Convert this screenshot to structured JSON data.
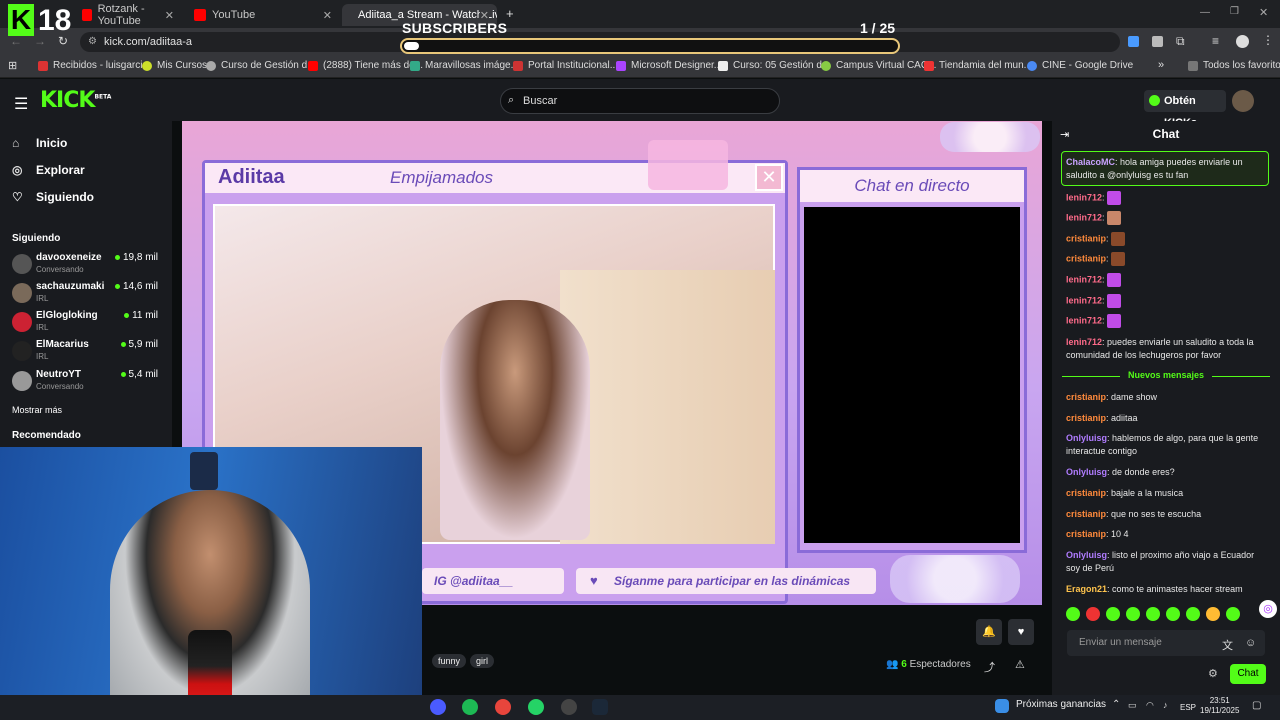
{
  "browser": {
    "tabs": [
      {
        "label": "Rotzank - YouTube"
      },
      {
        "label": "YouTube"
      },
      {
        "label": "Adiitaa_a Stream - Watch Live o"
      }
    ],
    "url": "kick.com/adiitaa-a",
    "bookmarks": [
      "Recibidos - luisgarci...",
      "Mis Cursos",
      "Curso de Gestión d...",
      "(2888) Tiene más de...",
      "Maravillosas imáge...",
      "Portal Institucional...",
      "Microsoft Designer...",
      "Curso: 05 Gestión d...",
      "Campus Virtual CAC...",
      "Tiendamia del mun...",
      "CINE - Google Drive",
      "Todos los favoritos"
    ]
  },
  "overlay_top": {
    "badge": "18",
    "sub_label": "SUBSCRIBERS",
    "sub_count": "1  / 25",
    "sub_progress": 0.04
  },
  "kick": {
    "logo": "KICK",
    "beta": "BETA",
    "search_placeholder": "Buscar",
    "get_kicks": "Obtén KICKs",
    "nav": [
      {
        "label": "Inicio",
        "icon": "home-icon"
      },
      {
        "label": "Explorar",
        "icon": "compass-icon"
      },
      {
        "label": "Siguiendo",
        "icon": "heart-icon"
      }
    ],
    "following_header": "Siguiendo",
    "following": [
      {
        "name": "davooxeneize",
        "status": "Conversando",
        "viewers": "19,8 mil"
      },
      {
        "name": "sachauzumaki",
        "status": "IRL",
        "viewers": "14,6 mil"
      },
      {
        "name": "ElGlogloking",
        "status": "IRL",
        "viewers": "11 mil"
      },
      {
        "name": "ElMacarius",
        "status": "IRL",
        "viewers": "5,9 mil"
      },
      {
        "name": "NeutroYT",
        "status": "Conversando",
        "viewers": "5,4 mil"
      }
    ],
    "show_more": "Mostrar más",
    "recommended": "Recomendado"
  },
  "stream_overlay": {
    "name": "Adiitaa",
    "title": "Empijamados",
    "live_chat": "Chat en directo",
    "ig": "IG @adiitaa__",
    "follow_msg": "Síganme para participar en las dinámicas"
  },
  "below_stream": {
    "tags": [
      "funny",
      "girl"
    ],
    "viewers_count": "6",
    "viewers_label": "Espectadores"
  },
  "chat": {
    "title": "Chat",
    "pinned": {
      "user": "ChalacoMC",
      "text": "hola amiga puedes enviarle un saludito a @onlyluisg es tu fan"
    },
    "messages": [
      {
        "user": "lenin712",
        "text": "",
        "color": "#ff6b8a"
      },
      {
        "user": "lenin712",
        "text": "",
        "color": "#ff6b8a"
      },
      {
        "user": "cristianip",
        "text": "",
        "color": "#ff8a3c"
      },
      {
        "user": "cristianip",
        "text": "",
        "color": "#ff8a3c"
      },
      {
        "user": "lenin712",
        "text": "",
        "color": "#ff6b8a"
      },
      {
        "user": "lenin712",
        "text": "",
        "color": "#ff6b8a"
      },
      {
        "user": "lenin712",
        "text": "",
        "color": "#ff6b8a"
      },
      {
        "user": "lenin712",
        "text": "puedes enviarle un saludito a toda la comunidad de los lechugeros por favor",
        "color": "#ff6b8a"
      }
    ],
    "new_messages": "Nuevos mensajes",
    "messages2": [
      {
        "user": "cristianip",
        "text": "dame show",
        "color": "#ff8a3c"
      },
      {
        "user": "cristianip",
        "text": "adiitaa",
        "color": "#ff8a3c"
      },
      {
        "user": "Onlyluisg",
        "text": "hablemos de algo, para que la gente interactue contigo",
        "color": "#b07cff"
      },
      {
        "user": "Onlyluisg",
        "text": "de donde eres?",
        "color": "#b07cff"
      },
      {
        "user": "cristianip",
        "text": "bajale a la musica",
        "color": "#ff8a3c"
      },
      {
        "user": "cristianip",
        "text": "que no ses te escucha",
        "color": "#ff8a3c"
      },
      {
        "user": "cristianip",
        "text": "10 4",
        "color": "#ff8a3c"
      },
      {
        "user": "Onlyluisg",
        "text": "listo el proximo año viajo a Ecuador soy de Perú",
        "color": "#b07cff"
      },
      {
        "user": "Eragon21",
        "text": "como te animastes hacer stream",
        "color": "#ffc44d"
      }
    ],
    "input_placeholder": "Enviar un mensaje",
    "send_button": "Chat"
  },
  "taskbar": {
    "gains": "Próximas ganancias",
    "lang": "ESP",
    "time": "23:51",
    "date": "19/11/2025"
  },
  "colors": {
    "kick_green": "#53fc18",
    "bg": "#0b0e0f",
    "panel": "#191b1f",
    "overlay_purple": "#6a4bb8"
  }
}
